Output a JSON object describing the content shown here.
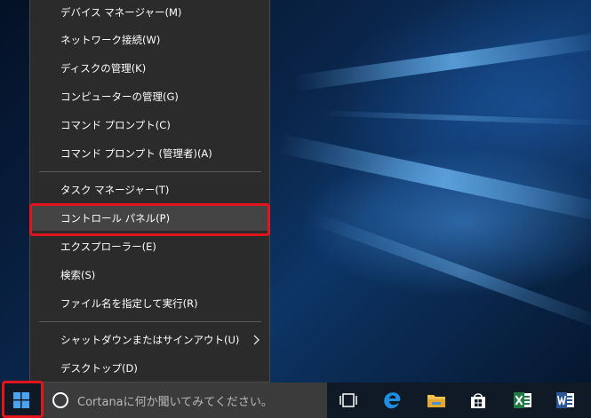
{
  "context_menu": {
    "items": [
      {
        "label": "デバイス マネージャー(M)"
      },
      {
        "label": "ネットワーク接続(W)"
      },
      {
        "label": "ディスクの管理(K)"
      },
      {
        "label": "コンピューターの管理(G)"
      },
      {
        "label": "コマンド プロンプト(C)"
      },
      {
        "label": "コマンド プロンプト (管理者)(A)"
      },
      {
        "label": "タスク マネージャー(T)"
      },
      {
        "label": "コントロール パネル(P)",
        "highlighted": true
      },
      {
        "label": "エクスプローラー(E)"
      },
      {
        "label": "検索(S)"
      },
      {
        "label": "ファイル名を指定して実行(R)"
      },
      {
        "label": "シャットダウンまたはサインアウト(U)",
        "has_submenu": true
      },
      {
        "label": "デスクトップ(D)"
      }
    ]
  },
  "taskbar": {
    "search_placeholder": "Cortanaに何か聞いてみてください。",
    "pinned": [
      "task-view-icon",
      "edge-icon",
      "file-explorer-icon",
      "store-icon",
      "excel-icon",
      "word-icon"
    ]
  },
  "colors": {
    "menu_bg": "#2b2b2b",
    "highlight_bg": "#444444",
    "annotation_red": "#e3141b",
    "taskbar_bg": "#101a27"
  }
}
